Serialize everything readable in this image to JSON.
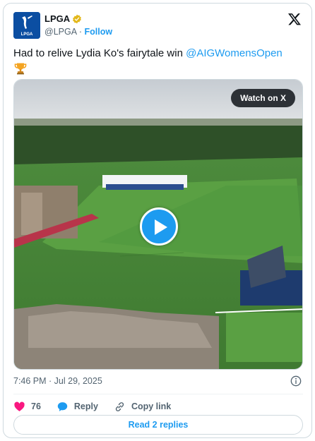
{
  "author": {
    "name": "LPGA",
    "handle": "@LPGA",
    "separator": "·",
    "follow_label": "Follow",
    "avatar_caption": "LPGA"
  },
  "tweet": {
    "text_before": "Had to relive Lydia Ko's fairytale win ",
    "mention": "@AIGWomensOpen",
    "emoji_icon": "trophy-icon"
  },
  "media": {
    "watch_label": "Watch on X",
    "play_icon": "play-icon"
  },
  "meta": {
    "timestamp": "7:46 PM · Jul 29, 2025"
  },
  "actions": {
    "like_count": "76",
    "reply_label": "Reply",
    "copy_label": "Copy link"
  },
  "footer": {
    "read_replies_label": "Read 2 replies"
  },
  "colors": {
    "accent": "#1d9bf0",
    "like": "#f91880",
    "text": "#0f1419",
    "muted": "#536471"
  }
}
